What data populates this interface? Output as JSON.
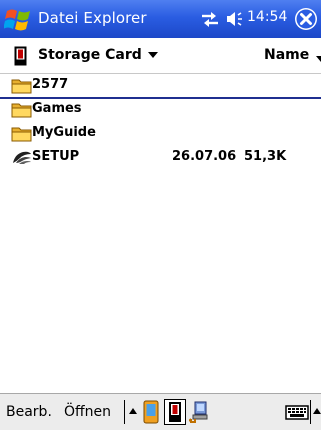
{
  "titlebar": {
    "start_icon": "windows-flag-icon",
    "title": "Datei Explorer",
    "connectivity_icon": "connectivity-icon",
    "volume_icon": "speaker-icon",
    "clock": "14:54",
    "close_icon": "close-icon",
    "color": "#2a5de2"
  },
  "header": {
    "location_icon": "storage-card-icon",
    "location": "Storage Card",
    "sort_label": "Name"
  },
  "files": [
    {
      "icon": "folder-icon",
      "name": "2577",
      "date": "",
      "size": "",
      "selected": true
    },
    {
      "icon": "folder-icon",
      "name": "Games",
      "date": "",
      "size": "",
      "selected": false
    },
    {
      "icon": "folder-icon",
      "name": "MyGuide",
      "date": "",
      "size": "",
      "selected": false
    },
    {
      "icon": "setup-icon",
      "name": "SETUP",
      "date": "26.07.06",
      "size": "51,3K",
      "selected": false
    }
  ],
  "menubar": {
    "edit_label": "Bearb.",
    "open_label": "Öffnen",
    "icons": [
      "up-arrow-icon",
      "device-memory-icon",
      "storage-card-icon",
      "network-share-icon",
      "keyboard-icon",
      "up-arrow-icon"
    ]
  }
}
